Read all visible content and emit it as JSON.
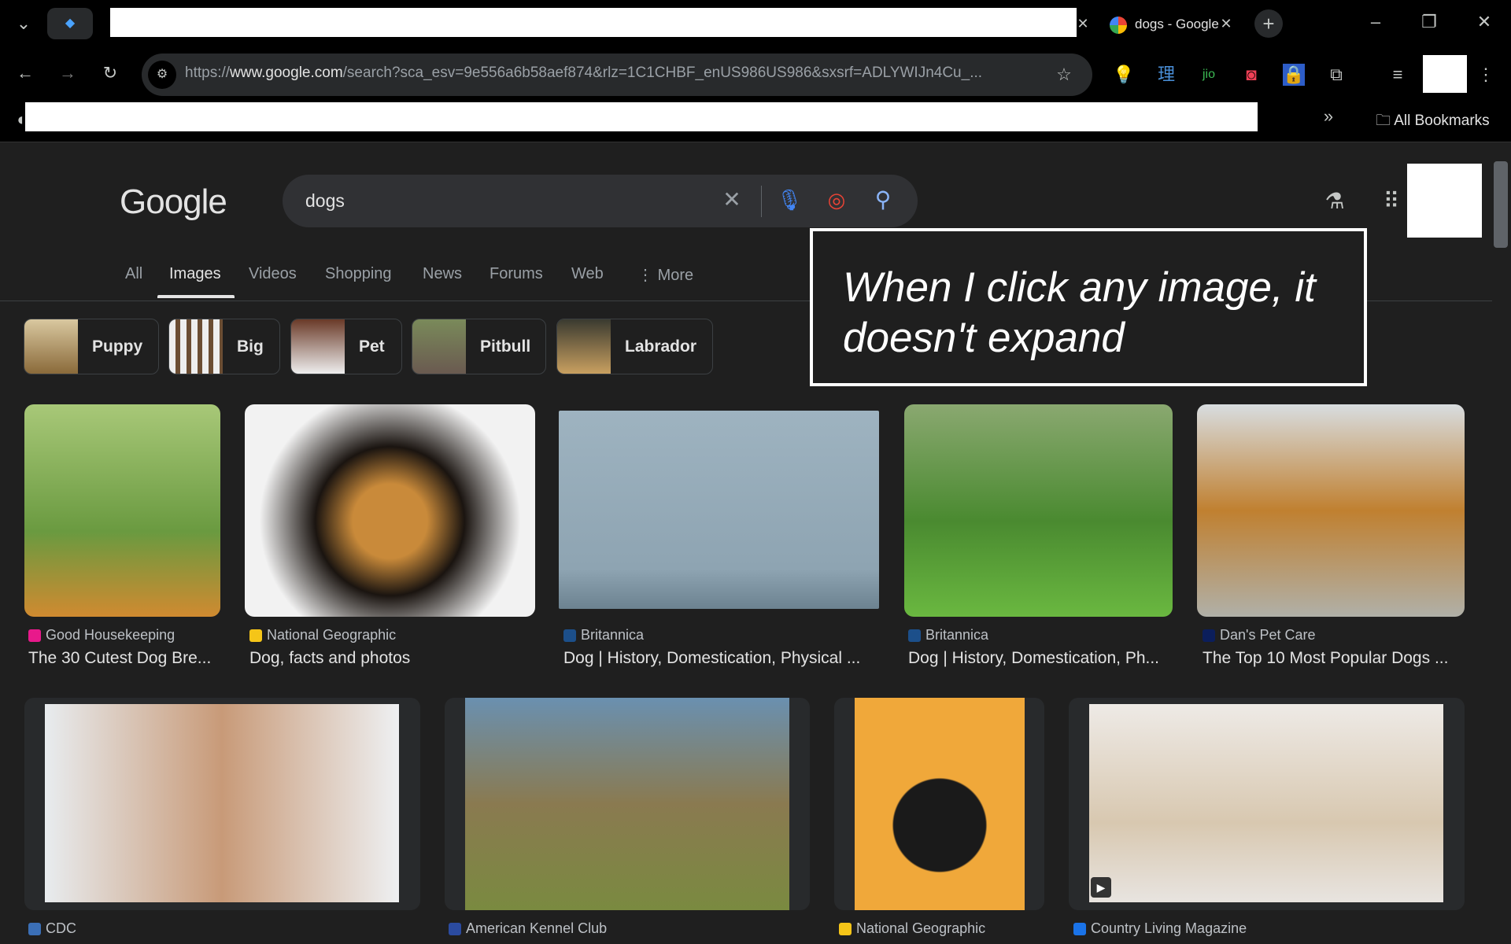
{
  "browser": {
    "tab_title": "dogs - Google",
    "url_prefix": "https://",
    "url_host": "www.google.com",
    "url_rest": "/search?sca_esv=9e556a6b58aef874&rlz=1C1CHBF_enUS986US986&sxsrf=ADLYWIJn4Cu_...",
    "all_bookmarks": "All Bookmarks"
  },
  "google": {
    "logo": "Google",
    "query": "dogs",
    "tabs": [
      "All",
      "Images",
      "Videos",
      "Shopping",
      "News",
      "Forums",
      "Web",
      "More"
    ],
    "active_tab": "Images",
    "chips": [
      {
        "label": "Puppy"
      },
      {
        "label": "Big"
      },
      {
        "label": "Pet"
      },
      {
        "label": "Pitbull"
      },
      {
        "label": "Labrador"
      }
    ]
  },
  "annotation": "When I click any image, it doesn't expand",
  "results_row1": [
    {
      "source": "Good Housekeeping",
      "title": "The 30 Cutest Dog Bre...",
      "fav": "#e8198b"
    },
    {
      "source": "National Geographic",
      "title": "Dog, facts and photos",
      "fav": "#f5c518"
    },
    {
      "source": "Britannica",
      "title": "Dog | History, Domestication, Physical ...",
      "fav": "#1c4f8a"
    },
    {
      "source": "Britannica",
      "title": "Dog | History, Domestication, Ph...",
      "fav": "#1c4f8a"
    },
    {
      "source": "Dan's Pet Care",
      "title": "The Top 10 Most Popular Dogs ...",
      "fav": "#0b1e5b"
    }
  ],
  "results_row2": [
    {
      "source": "CDC",
      "fav": "#3b6fb6"
    },
    {
      "source": "American Kennel Club",
      "fav": "#2b4ba0"
    },
    {
      "source": "National Geographic",
      "fav": "#f5c518"
    },
    {
      "source": "Country Living Magazine",
      "fav": "#1a73e8"
    }
  ]
}
